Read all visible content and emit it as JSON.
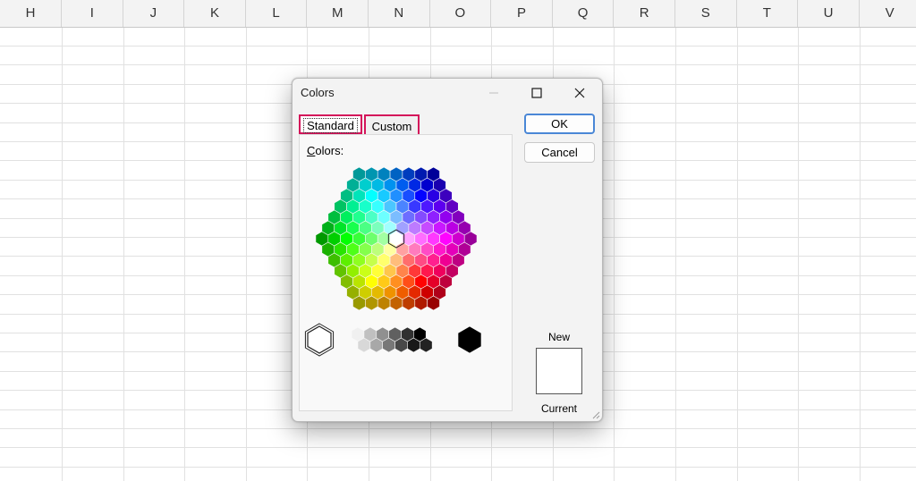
{
  "sheet": {
    "columns": [
      "H",
      "I",
      "J",
      "K",
      "L",
      "M",
      "N",
      "O",
      "P",
      "Q",
      "R",
      "S",
      "T",
      "U",
      "V"
    ]
  },
  "dialog": {
    "title": "Colors",
    "tabs": {
      "standard": "Standard",
      "custom": "Custom"
    },
    "colors_label": {
      "mnemonic": "C",
      "rest": "olors:"
    },
    "ok_label": "OK",
    "cancel_label": "Cancel",
    "new_label": "New",
    "current_label": "Current",
    "new_color": "#ffffff",
    "current_color": "#ffffff",
    "selected_color": "#ffffff",
    "highlight_color": "#d4145a",
    "icons": {
      "minimize": "minimize-icon",
      "maximize": "maximize-icon",
      "close": "close-icon"
    }
  }
}
